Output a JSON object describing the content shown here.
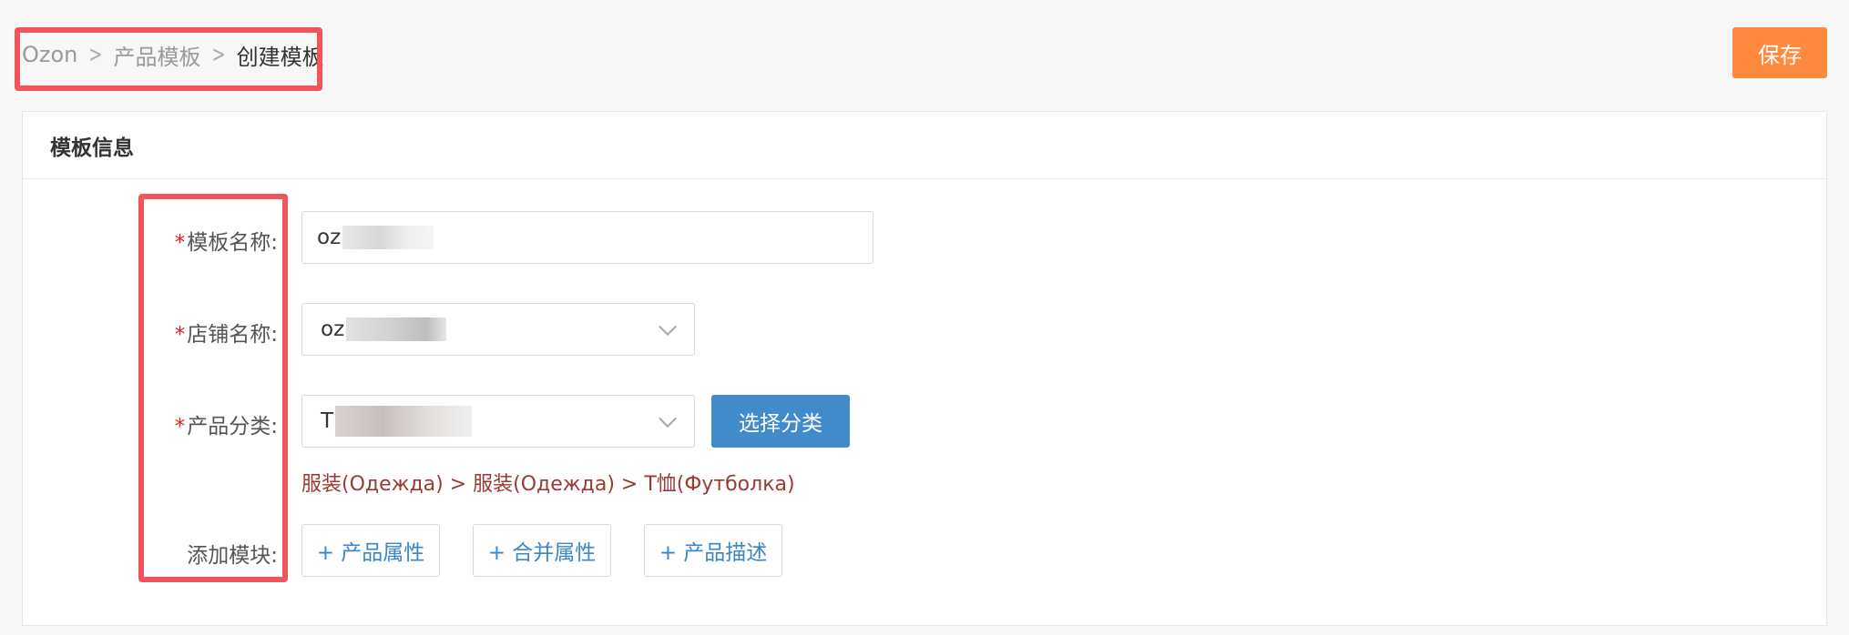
{
  "breadcrumb": {
    "items": [
      "Ozon",
      "产品模板"
    ],
    "current": "创建模板"
  },
  "toolbar": {
    "save_label": "保存"
  },
  "card": {
    "title": "模板信息"
  },
  "form": {
    "template_name": {
      "required": "*",
      "label": "模板名称:",
      "value": "oz"
    },
    "store_name": {
      "required": "*",
      "label": "店铺名称:",
      "value": "oz"
    },
    "product_category": {
      "required": "*",
      "label": "产品分类:",
      "value": "T",
      "choose_button": "选择分类",
      "path": "服装(Одежда) > 服装(Одежда) > T恤(Футболка)"
    },
    "add_module": {
      "label": "添加模块:",
      "buttons": [
        "+ 产品属性",
        "+ 合并属性",
        "+ 产品描述"
      ]
    }
  },
  "colors": {
    "annotation": "#f0555b",
    "save_button": "#ff8a3d",
    "primary_button": "#428bca",
    "category_path": "#9b3a32"
  }
}
